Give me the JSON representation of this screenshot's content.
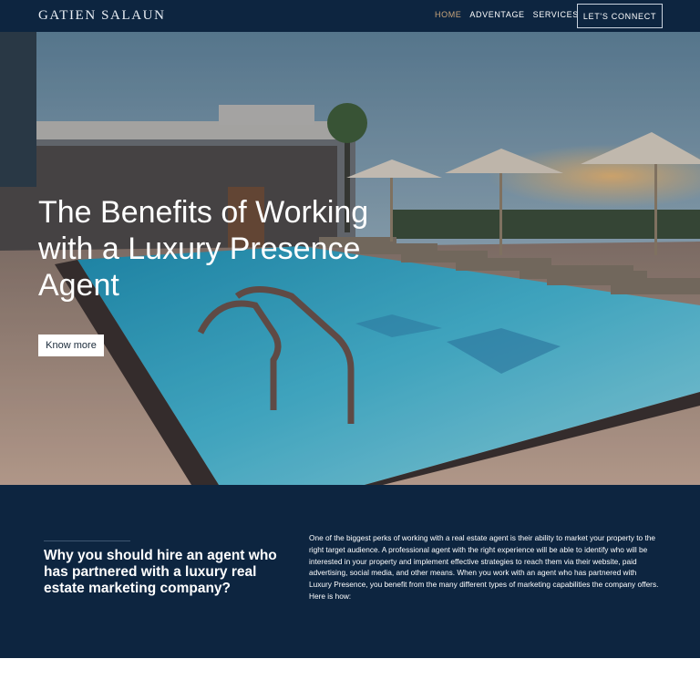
{
  "nav": {
    "logo": "GATIEN SALAUN",
    "links": [
      {
        "label": "HOME",
        "active": true
      },
      {
        "label": "ADVENTAGE",
        "active": false
      },
      {
        "label": "SERVICES",
        "active": false
      }
    ],
    "cta": "LET'S CONNECT"
  },
  "hero": {
    "title": "The Benefits of Working with a Luxury Presence Agent",
    "button": "Know more"
  },
  "info": {
    "heading": "Why you should hire an agent who has partnered with a luxury real estate marketing company?",
    "body": "One of the biggest perks of working with a real estate agent is their ability to market your property to the right target audience. A professional agent with the right experience will be able to identify who will be interested in your property and implement effective strategies to reach them via their website, paid advertising, social media, and other means. When you work with an agent who has partnered with Luxury Presence, you benefit from the many different types of marketing capabilities the company offers. Here is how:"
  },
  "colors": {
    "navy": "#0d2540",
    "accent": "#c9a57b"
  }
}
